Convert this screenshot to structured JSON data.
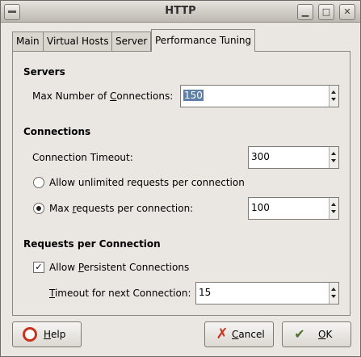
{
  "window": {
    "title": "HTTP",
    "minimize_icon": "minimize-icon",
    "maximize_icon": "maximize-icon",
    "close_icon": "close-icon"
  },
  "tabs": [
    {
      "label": "Main",
      "active": false
    },
    {
      "label": "Virtual Hosts",
      "active": false
    },
    {
      "label": "Server",
      "active": false
    },
    {
      "label": "Performance Tuning",
      "active": true
    }
  ],
  "servers": {
    "heading": "Servers",
    "max_connections_label_pre": "Max Number of ",
    "max_connections_label_ul": "C",
    "max_connections_label_post": "onnections:",
    "max_connections_value": "150"
  },
  "connections": {
    "heading": "Connections",
    "timeout_label": "Connection Timeout:",
    "timeout_value": "300",
    "unlimited_label": "Allow unlimited requests per connection",
    "unlimited_selected": false,
    "max_requests_label_pre": "Max ",
    "max_requests_label_ul": "r",
    "max_requests_label_post": "equests per connection:",
    "max_requests_value": "100",
    "max_requests_selected": true
  },
  "requests": {
    "heading": "Requests per Connection",
    "persistent_label_pre": "Allow ",
    "persistent_label_ul": "P",
    "persistent_label_post": "ersistent Connections",
    "persistent_checked": true,
    "next_timeout_label_ul": "T",
    "next_timeout_label_post": "imeout for next Connection:",
    "next_timeout_value": "15"
  },
  "buttons": {
    "help_ul": "H",
    "help_rest": "elp",
    "cancel_ul": "C",
    "cancel_rest": "ancel",
    "ok_ul": "O",
    "ok_rest": "K"
  }
}
